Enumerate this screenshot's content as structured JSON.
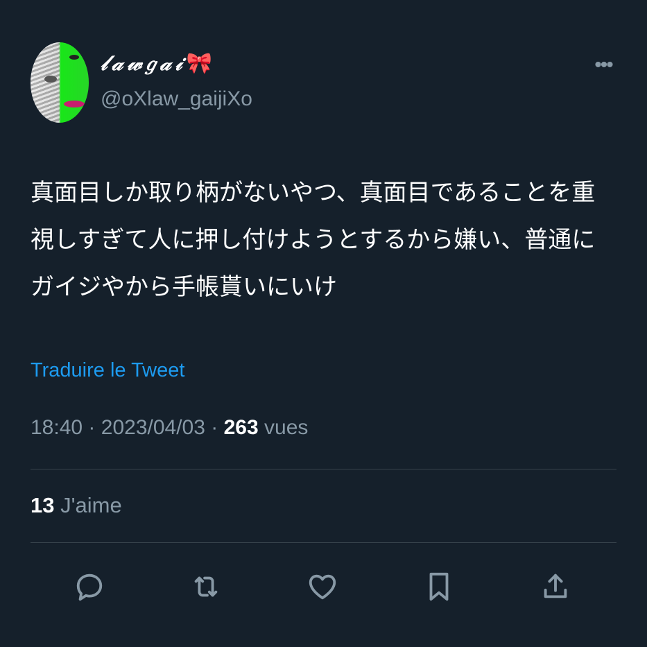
{
  "author": {
    "display_name": "𝓁𝒶𝓌𝑔𝒶𝒾",
    "display_name_emoji": "🎀",
    "handle": "@oXlaw_gaijiXo"
  },
  "tweet": {
    "text": "真面目しか取り柄がないやつ、真面目であることを重視しすぎて人に押し付けようとするから嫌い、普通にガイジやから手帳貰いにいけ",
    "translate_label": "Traduire le Tweet"
  },
  "meta": {
    "time": "18:40",
    "date": "2023/04/03",
    "views_count": "263",
    "views_label": "vues",
    "separator": "·"
  },
  "stats": {
    "likes_count": "13",
    "likes_label": "J'aime"
  },
  "more_label": "•••",
  "icons": [
    "reply-icon",
    "retweet-icon",
    "like-icon",
    "bookmark-icon",
    "share-icon"
  ],
  "colors": {
    "background": "#15202b",
    "text": "#ffffff",
    "secondary": "#8899a6",
    "link": "#1d9bf0",
    "divider": "#38444d"
  }
}
